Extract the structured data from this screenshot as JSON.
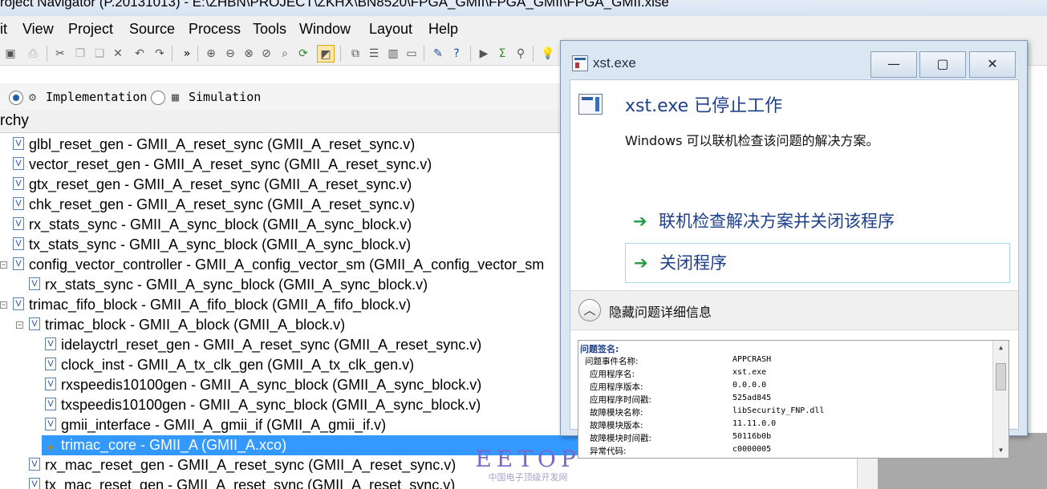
{
  "window": {
    "title": "roject Navigator (P.20131013) - E:\\ZHBN\\PROJECT\\ZKHX\\BN8520\\FPGA_GMII\\FPGA_GMII\\FPGA_GMII.xise"
  },
  "menu": {
    "items": [
      "it",
      "View",
      "Project",
      "Source",
      "Process",
      "Tools",
      "Window",
      "Layout",
      "Help"
    ]
  },
  "toolbar": {
    "overflow": "»"
  },
  "view": {
    "implementation": "Implementation",
    "simulation": "Simulation",
    "selected": "Implementation"
  },
  "hierarchy": {
    "title": "rchy",
    "rows": [
      {
        "text": "glbl_reset_gen - GMII_A_reset_sync (GMII_A_reset_sync.v)",
        "icon": "verilog-file-icon"
      },
      {
        "text": "vector_reset_gen - GMII_A_reset_sync (GMII_A_reset_sync.v)",
        "icon": "verilog-file-icon"
      },
      {
        "text": "gtx_reset_gen - GMII_A_reset_sync (GMII_A_reset_sync.v)",
        "icon": "verilog-file-icon"
      },
      {
        "text": "chk_reset_gen - GMII_A_reset_sync (GMII_A_reset_sync.v)",
        "icon": "verilog-file-icon"
      },
      {
        "text": "rx_stats_sync - GMII_A_sync_block (GMII_A_sync_block.v)",
        "icon": "verilog-file-icon"
      },
      {
        "text": "tx_stats_sync - GMII_A_sync_block (GMII_A_sync_block.v)",
        "icon": "verilog-file-icon"
      },
      {
        "text": "config_vector_controller - GMII_A_config_vector_sm (GMII_A_config_vector_sm",
        "icon": "verilog-file-icon"
      },
      {
        "text": "rx_stats_sync - GMII_A_sync_block (GMII_A_sync_block.v)",
        "icon": "verilog-file-icon"
      },
      {
        "text": "trimac_fifo_block - GMII_A_fifo_block (GMII_A_fifo_block.v)",
        "icon": "verilog-file-icon"
      },
      {
        "text": "trimac_block - GMII_A_block (GMII_A_block.v)",
        "icon": "verilog-file-icon"
      },
      {
        "text": "idelayctrl_reset_gen - GMII_A_reset_sync (GMII_A_reset_sync.v)",
        "icon": "verilog-file-icon"
      },
      {
        "text": "clock_inst - GMII_A_tx_clk_gen (GMII_A_tx_clk_gen.v)",
        "icon": "verilog-file-icon"
      },
      {
        "text": "rxspeedis10100gen - GMII_A_sync_block (GMII_A_sync_block.v)",
        "icon": "verilog-file-icon"
      },
      {
        "text": "txspeedis10100gen - GMII_A_sync_block (GMII_A_sync_block.v)",
        "icon": "verilog-file-icon"
      },
      {
        "text": "gmii_interface - GMII_A_gmii_if (GMII_A_gmii_if.v)",
        "icon": "verilog-file-icon"
      },
      {
        "text": "trimac_core - GMII_A (GMII_A.xco)",
        "icon": "ip-core-icon"
      },
      {
        "text": "rx_mac_reset_gen - GMII_A_reset_sync (GMII_A_reset_sync.v)",
        "icon": "verilog-file-icon"
      },
      {
        "text": "tx_mac_reset_gen - GMII_A_reset_sync (GMII_A_reset_sync.v)",
        "icon": "verilog-file-icon"
      }
    ]
  },
  "watermark": {
    "brand": "EETOP",
    "tagline": "中国电子顶级开发网"
  },
  "dialog": {
    "title": "xst.exe",
    "heading": "xst.exe 已停止工作",
    "description": "Windows 可以联机检查该问题的解决方案。",
    "option_online": "联机检查解决方案并关闭该程序",
    "option_close": "关闭程序",
    "toggle_details": "隐藏问题详细信息",
    "signature_label": "问题签名:",
    "details": [
      {
        "k": "问题事件名称:",
        "v": "APPCRASH"
      },
      {
        "k": "应用程序名:",
        "v": "xst.exe"
      },
      {
        "k": "应用程序版本:",
        "v": "0.0.0.0"
      },
      {
        "k": "应用程序时间戳:",
        "v": "525ad845"
      },
      {
        "k": "故障模块名称:",
        "v": "libSecurity_FNP.dll"
      },
      {
        "k": "故障模块版本:",
        "v": "11.11.0.0"
      },
      {
        "k": "故障模块时间戳:",
        "v": "50116b0b"
      },
      {
        "k": "异常代码:",
        "v": "c0000005"
      }
    ]
  }
}
